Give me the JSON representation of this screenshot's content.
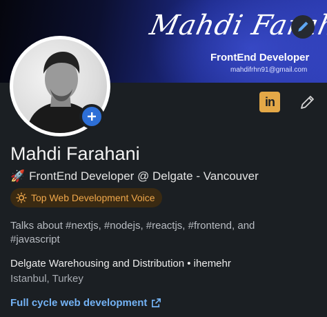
{
  "banner": {
    "signature": "Mahdi Farahani",
    "role": "FrontEnd Developer",
    "email": "mahdifrhn91@gmail.com"
  },
  "profile": {
    "name": "Mahdi Farahani",
    "headline_emoji": "🚀",
    "headline": "FrontEnd Developer @ Delgate - Vancouver",
    "badge": "Top Web Development Voice",
    "about": "Talks about #nextjs, #nodejs, #reactjs, #frontend, and #javascript",
    "company": "Delgate Warehousing and Distribution • ihemehr",
    "location": "Istanbul, Turkey",
    "website": "Full cycle web development"
  },
  "actions": {
    "linkedin_label": "in"
  },
  "colors": {
    "accent_blue": "#74b3f5",
    "badge_orange": "#f0a84b",
    "linkedin_gold": "#e4a847",
    "add_button": "#2d6fd7"
  },
  "icons": [
    "pencil-icon",
    "plus-icon",
    "linkedin-icon",
    "rocket-icon",
    "lightbulb-icon",
    "external-link-icon"
  ]
}
